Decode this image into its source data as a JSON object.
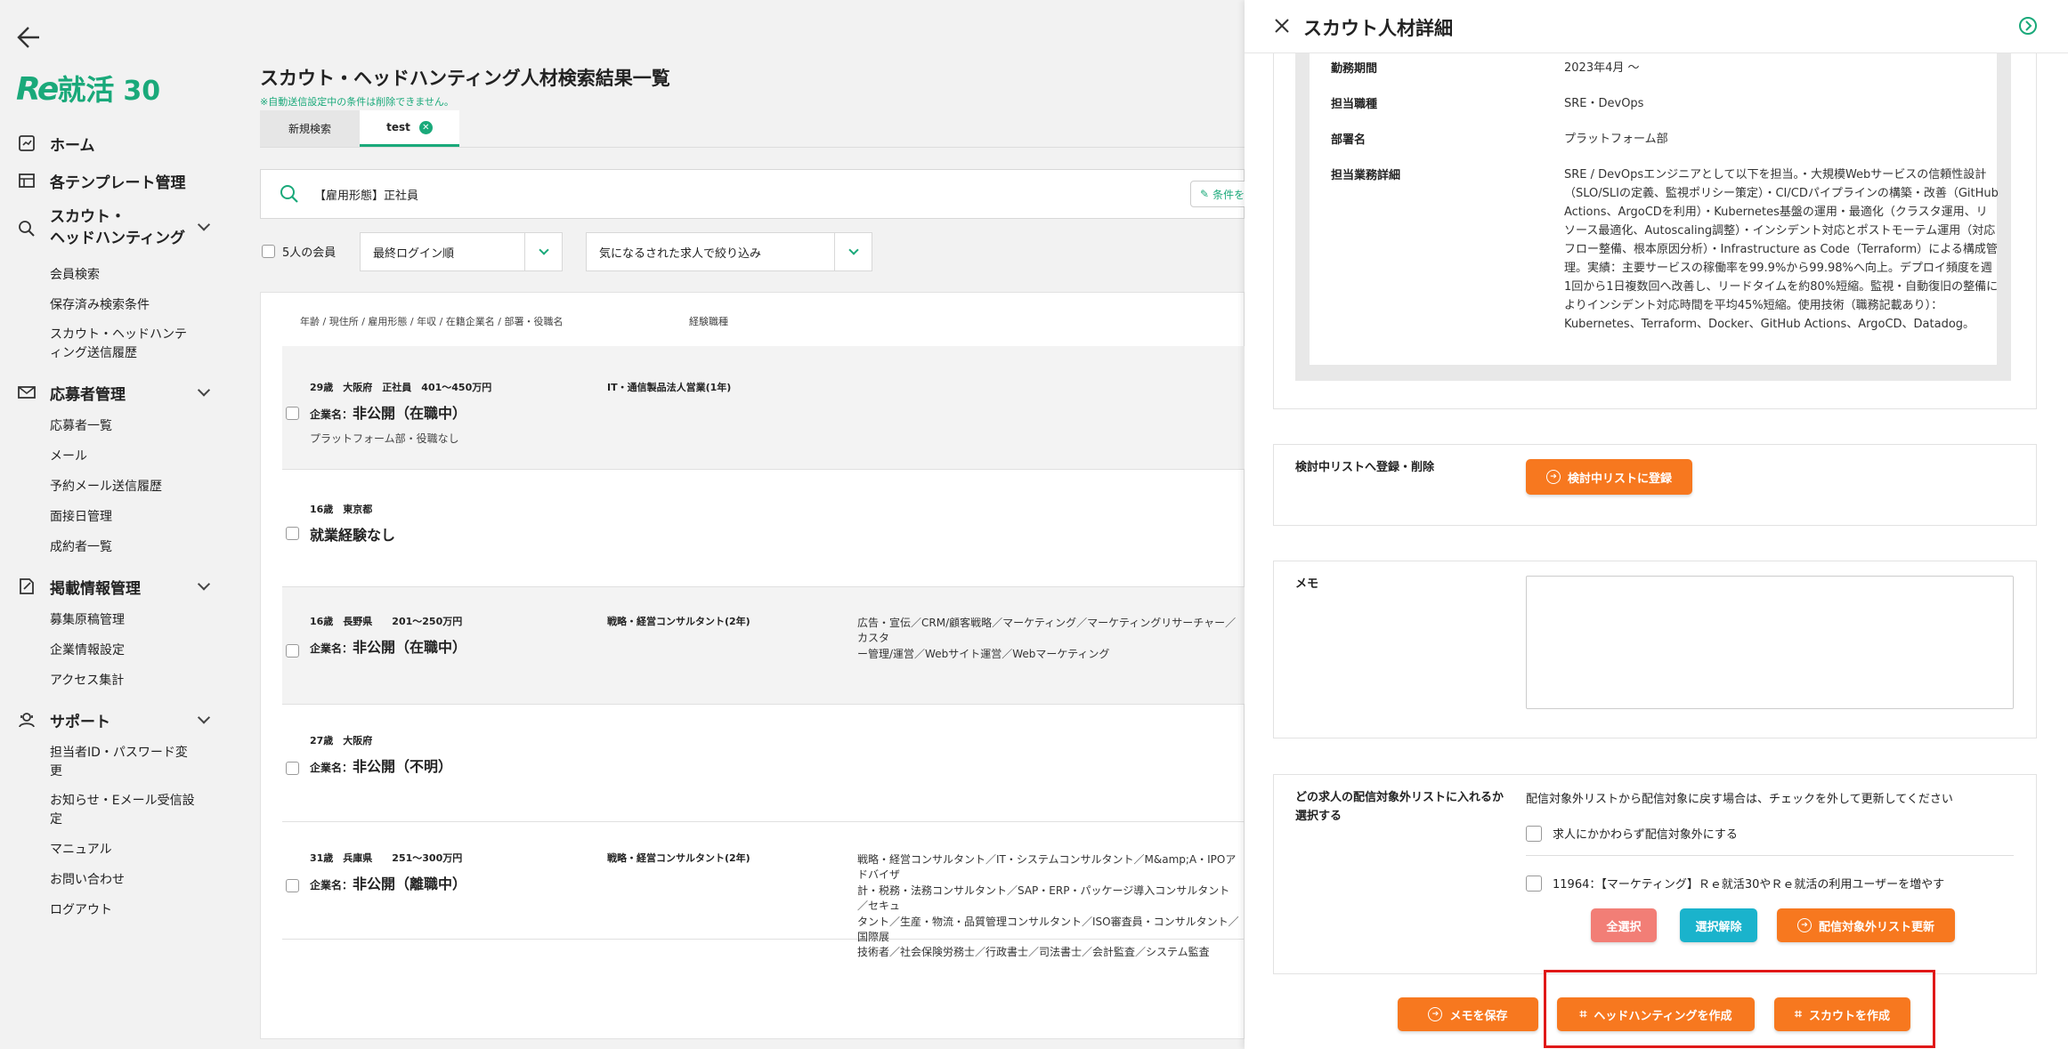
{
  "app": {
    "logo_text": "Re就活 30"
  },
  "sidebar": {
    "items": [
      {
        "label": "ホーム",
        "icon": "home-icon"
      },
      {
        "label": "各テンプレート管理",
        "icon": "template-icon"
      },
      {
        "label": "スカウト・\nヘッドハンティング",
        "icon": "search-icon",
        "children": [
          "会員検索",
          "保存済み検索条件",
          "スカウト・ヘッドハンティング送信履歴"
        ]
      },
      {
        "label": "応募者管理",
        "icon": "mail-icon",
        "children": [
          "応募者一覧",
          "メール",
          "予約メール送信履歴",
          "面接日管理",
          "成約者一覧"
        ]
      },
      {
        "label": "掲載情報管理",
        "icon": "edit-doc-icon",
        "children": [
          "募集原稿管理",
          "企業情報設定",
          "アクセス集計"
        ]
      },
      {
        "label": "サポート",
        "icon": "support-icon",
        "children": [
          "担当者ID・パスワード変更",
          "お知らせ・Eメール受信設定",
          "マニュアル",
          "お問い合わせ",
          "ログアウト"
        ]
      }
    ]
  },
  "main": {
    "title": "スカウト・ヘッドハンティング人材検索結果一覧",
    "note": "※自動送信設定中の条件は削除できません。",
    "tabs": [
      {
        "label": "新規検索"
      },
      {
        "label": "test"
      }
    ],
    "search_condition": "【雇用形態】正社員",
    "condition_button": "条件を",
    "members_label": "5人の会員",
    "sort_select": "最終ログイン順",
    "filter_select": "気になるされた求人で絞り込み",
    "columns": [
      "年齢 / 現住所 / 雇用形態 / 年収 / 在籍企業名 / 部署・役職名",
      "経験職種"
    ],
    "rows": [
      {
        "meta": "29歳　大阪府　正社員　401〜450万円",
        "company_label": "企業名：",
        "company": "非公開（在職中）",
        "dept": "プラットフォーム部・役職なし",
        "experience": "IT・通信製品法人営業(1年)",
        "jobs": ""
      },
      {
        "meta": "16歳　東京都",
        "company_label": "",
        "company": "就業経験なし",
        "dept": "",
        "experience": "",
        "jobs": ""
      },
      {
        "meta": "16歳　長野県　　201〜250万円",
        "company_label": "企業名：",
        "company": "非公開（在職中）",
        "dept": "",
        "experience": "戦略・経営コンサルタント(2年)",
        "jobs": "広告・宣伝／CRM/顧客戦略／マーケティング／マーケティングリサーチャー／カスタ\nー管理/運営／Webサイト運営／Webマーケティング"
      },
      {
        "meta": "27歳　大阪府",
        "company_label": "企業名：",
        "company": "非公開（不明）",
        "dept": "",
        "experience": "",
        "jobs": ""
      },
      {
        "meta": "31歳　兵庫県　　251〜300万円",
        "company_label": "企業名：",
        "company": "非公開（離職中）",
        "dept": "",
        "experience": "戦略・経営コンサルタント(2年)",
        "jobs": "戦略・経営コンサルタント／IT・システムコンサルタント／M&amp;A・IPOアドバイザ\n計・税務・法務コンサルタント／SAP・ERP・パッケージ導入コンサルタント／セキュ\nタント／生産・物流・品質管理コンサルタント／ISO審査員・コンサルタント／国際展\n技術者／社会保険労務士／行政書士／司法書士／会計監査／システム監査"
      }
    ]
  },
  "panel": {
    "title": "スカウト人材詳細",
    "career": [
      {
        "key": "勤務期間",
        "value": "2023年4月 〜"
      },
      {
        "key": "担当職種",
        "value": "SRE・DevOps"
      },
      {
        "key": "部署名",
        "value": "プラットフォーム部"
      },
      {
        "key": "担当業務詳細",
        "value": "SRE / DevOpsエンジニアとして以下を担当。・大規模Webサービスの信頼性設計（SLO/SLIの定義、監視ポリシー策定）・CI/CDパイプラインの構築・改善（GitHub Actions、ArgoCDを利用）・Kubernetes基盤の運用・最適化（クラスタ運用、リソース最適化、Autoscaling調整）・インシデント対応とポストモーテム運用（対応フロー整備、根本原因分析）・Infrastructure as Code（Terraform）による構成管理。実績：主要サービスの稼働率を99.9%から99.98%へ向上。デプロイ頻度を週1回から1日複数回へ改善し、リードタイムを約80%短縮。監視・自動復旧の整備によりインシデント対応時間を平均45%短縮。使用技術（職務記載あり）：Kubernetes、Terraform、Docker、GitHub Actions、ArgoCD、Datadog。"
      }
    ],
    "shortlist": {
      "label": "検討中リストへ登録・削除",
      "button": "検討中リストに登録"
    },
    "memo": {
      "label": "メモ",
      "value": ""
    },
    "exclusion": {
      "label": "どの求人の配信対象外リストに入れるか選択する",
      "hint": "配信対象外リストから配信対象に戻す場合は、チェックを外して更新してください",
      "option_all": "求人にかかわらず配信対象外にする",
      "option_job": "11964：【マーケティング】Ｒｅ就活30やＲｅ就活の利用ユーザーを増やす",
      "select_all": "全選択",
      "deselect": "選択解除",
      "update": "配信対象外リスト更新"
    },
    "footer": {
      "save_memo": "メモを保存",
      "headhunt": "ヘッドハンティングを作成",
      "scout": "スカウトを作成"
    }
  },
  "colors": {
    "accent_green": "#1aa97a",
    "accent_orange": "#f7781f",
    "highlight_red": "#e01818"
  }
}
